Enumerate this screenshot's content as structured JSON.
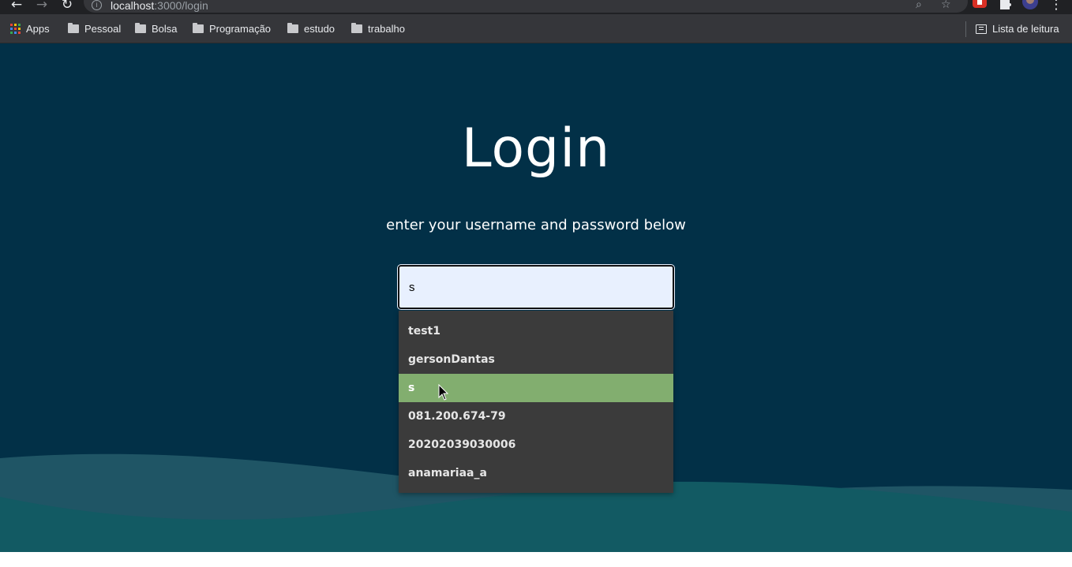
{
  "browser": {
    "url_host": "localhost",
    "url_path": ":3000/login",
    "nav": {
      "back_icon": "arrow-left",
      "forward_icon": "arrow-right",
      "reload_icon": "reload"
    },
    "bookmarks": [
      {
        "label": "Apps",
        "icon": "apps-grid-icon"
      },
      {
        "label": "Pessoal",
        "icon": "folder-icon"
      },
      {
        "label": "Bolsa",
        "icon": "folder-icon"
      },
      {
        "label": "Programação",
        "icon": "folder-icon"
      },
      {
        "label": "estudo",
        "icon": "folder-icon"
      },
      {
        "label": "trabalho",
        "icon": "folder-icon"
      }
    ],
    "reading_list": "Lista de leitura"
  },
  "page": {
    "title": "Login",
    "subtitle": "enter your username and password below",
    "username_value": "s",
    "autocomplete": [
      "test1",
      "gersonDantas",
      "s",
      "081.200.674-79",
      "20202039030006",
      "anamariaa_a"
    ],
    "selected_index": 2
  },
  "colors": {
    "background": "#023047",
    "wave_mid": "#1f5565",
    "wave_front": "#125a63",
    "highlight": "#82ae6f"
  }
}
